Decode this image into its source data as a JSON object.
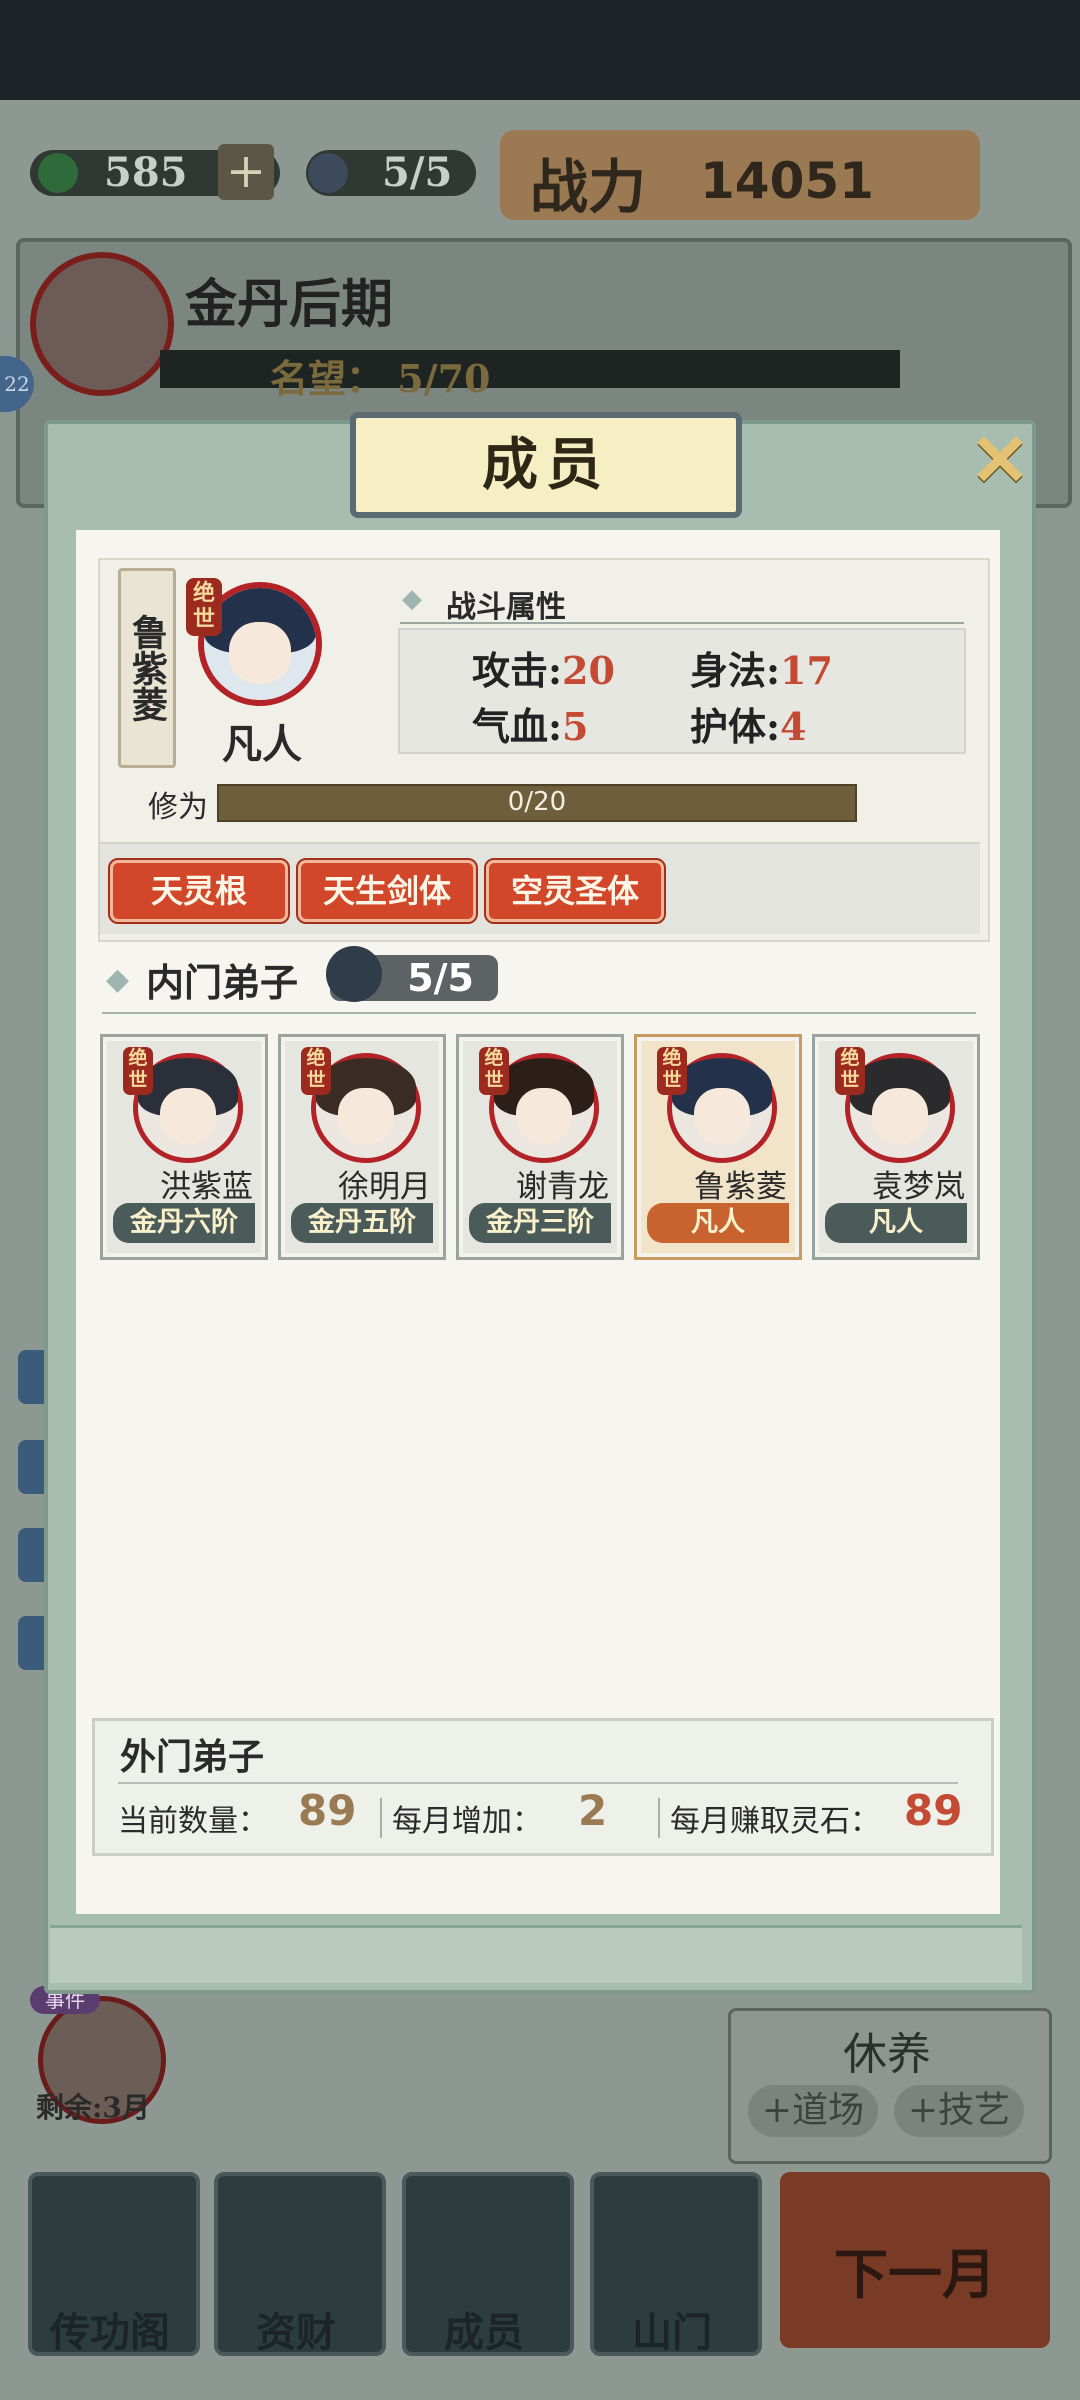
{
  "resources": {
    "spirit_stone": "585",
    "plus": "+",
    "members": "5/5"
  },
  "power": {
    "label": "战力",
    "value": "14051"
  },
  "profile": {
    "realm": "金丹后期",
    "fame_label": "名望：",
    "fame_value": "5/70",
    "level_badge": "22"
  },
  "dialog": {
    "title": "成员",
    "close": "✕",
    "selected_member": {
      "name": "鲁紫菱",
      "badge": "绝世",
      "realm": "凡人",
      "stats_header": "战斗属性",
      "stats": [
        {
          "label": "攻击:",
          "value": "20"
        },
        {
          "label": "身法:",
          "value": "17"
        },
        {
          "label": "气血:",
          "value": "5"
        },
        {
          "label": "护体:",
          "value": "4"
        }
      ],
      "cultivation_label": "修为",
      "cultivation_text": "0/20",
      "cultivation_progress": 0,
      "traits": [
        "天灵根",
        "天生剑体",
        "空灵圣体"
      ]
    },
    "inner_disciples": {
      "title": "内门弟子",
      "count": "5/5",
      "members": [
        {
          "badge": "绝世",
          "name": "洪紫蓝",
          "rank": "金丹六阶",
          "selected": false
        },
        {
          "badge": "绝世",
          "name": "徐明月",
          "rank": "金丹五阶",
          "selected": false
        },
        {
          "badge": "绝世",
          "name": "谢青龙",
          "rank": "金丹三阶",
          "selected": false
        },
        {
          "badge": "绝世",
          "name": "鲁紫菱",
          "rank": "凡人",
          "selected": true
        },
        {
          "badge": "绝世",
          "name": "袁梦岚",
          "rank": "凡人",
          "selected": false
        }
      ]
    },
    "outer_disciples": {
      "title": "外门弟子",
      "current_label": "当前数量：",
      "current_value": "89",
      "monthly_add_label": "每月增加：",
      "monthly_add_value": "2",
      "monthly_stone_label": "每月赚取灵石：",
      "monthly_stone_value": "89"
    }
  },
  "event": {
    "badge": "事件",
    "remaining": "剩余:3月"
  },
  "rest_panel": {
    "title": "休养",
    "dojo": "+道场",
    "skill": "+技艺"
  },
  "bottom_nav": [
    {
      "label": "传功阁",
      "icon": "pavilion-icon"
    },
    {
      "label": "资财",
      "icon": "money-bag-icon"
    },
    {
      "label": "成员",
      "icon": "members-icon"
    },
    {
      "label": "山门",
      "icon": "mountain-gate-icon"
    }
  ],
  "next_month": "下一月",
  "colors": {
    "accent_red": "#d2472a",
    "value_red": "#c54a33",
    "outer_value_brown": "#9a7a52"
  }
}
